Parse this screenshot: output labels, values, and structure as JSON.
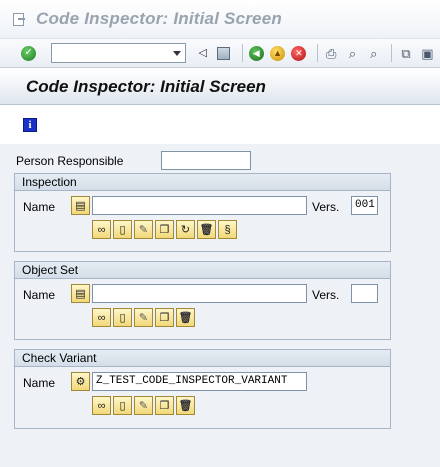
{
  "window": {
    "title": "Code Inspector: Initial Screen"
  },
  "toolbar": {
    "command_field": {
      "value": ""
    },
    "icons": [
      "check-icon",
      "command-field-dropdown",
      "back-arrow-icon",
      "save-icon",
      "back-icon",
      "exit-icon",
      "cancel-icon",
      "print-icon",
      "find-icon",
      "find-next-icon",
      "new-session-icon"
    ]
  },
  "screen": {
    "title": "Code Inspector: Initial Screen"
  },
  "form": {
    "person_responsible": {
      "label": "Person Responsible",
      "value": ""
    },
    "inspection": {
      "title": "Inspection",
      "name_label": "Name",
      "name_value": "",
      "vers_label": "Vers.",
      "vers_value": "001"
    },
    "object_set": {
      "title": "Object Set",
      "name_label": "Name",
      "name_value": "",
      "vers_label": "Vers.",
      "vers_value": ""
    },
    "check_variant": {
      "title": "Check Variant",
      "name_label": "Name",
      "name_value": "Z_TEST_CODE_INSPECTOR_VARIANT"
    }
  }
}
